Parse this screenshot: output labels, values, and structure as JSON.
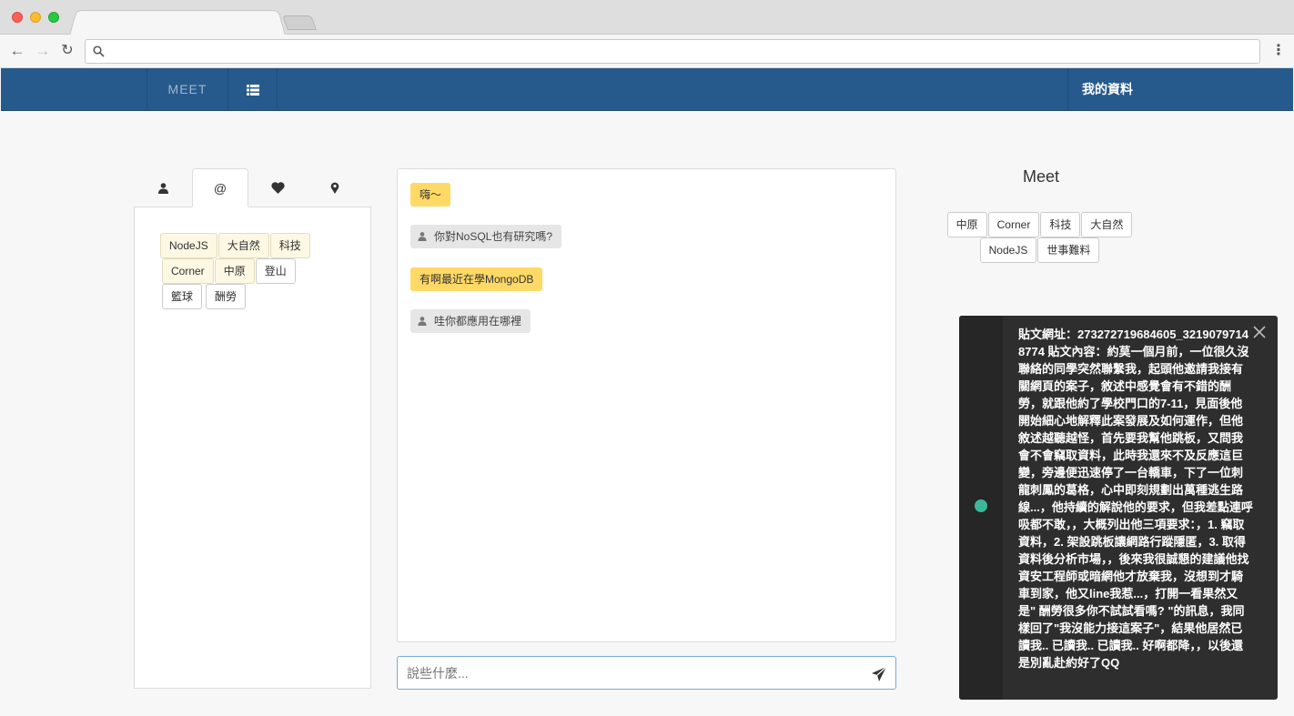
{
  "browser": {
    "tab_title": "",
    "address": ""
  },
  "navbar": {
    "brand": "MEET",
    "right_link": "我的資料"
  },
  "left_tabs": [
    {
      "name": "user-tab",
      "icon": "user-icon"
    },
    {
      "name": "at-tab",
      "label": "@"
    },
    {
      "name": "heart-tab",
      "icon": "heart-icon"
    },
    {
      "name": "location-tab",
      "icon": "map-marker-icon"
    }
  ],
  "interest_tags": {
    "row1": [
      "NodeJS",
      "大自然",
      "科技"
    ],
    "row2": [
      "Corner",
      "中原",
      "登山"
    ],
    "row3": [
      "籃球",
      "酬勞"
    ]
  },
  "chat": {
    "messages": [
      {
        "from": "me",
        "text": "嗨～"
      },
      {
        "from": "other",
        "text": "你對NoSQL也有研究嗎?"
      },
      {
        "from": "me",
        "text": "有啊最近在學MongoDB"
      },
      {
        "from": "other",
        "text": "哇你都應用在哪裡"
      }
    ],
    "input_placeholder": "說些什麼..."
  },
  "match": {
    "title": "Meet",
    "tags_row1": [
      "中原",
      "Corner",
      "科技",
      "大自然"
    ],
    "tags_row2": [
      "NodeJS",
      "世事難料"
    ]
  },
  "notification": {
    "text": "貼文網址：273272719684605_32190797148774 貼文內容：約莫一個月前，一位很久沒聯絡的同學突然聯繫我，起頭他邀請我接有關網頁的案子，敘述中感覺會有不錯的酬勞，就跟他約了學校門口的7-11，見面後他開始細心地解釋此案發展及如何運作，但他敘述越聽越怪，首先要我幫他跳板，又問我會不會竊取資料，此時我還來不及反應這巨變，旁邊便迅速停了一台轎車，下了一位刺龍刺鳳的葛格，心中即刻規劃出萬種逃生路線...，他持續的解說他的要求，但我差點連呼吸都不敢，，大概列出他三項要求：，1. 竊取資料，2. 架設跳板讓網路行蹤隱匿，3. 取得資料後分析市場，，後來我很誠懇的建議他找資安工程師或暗網他才放棄我，沒想到才騎車到家，他又line我惹...，打開一看果然又是\" 酬勞很多你不試試看嗎? \"的訊息，我同樣回了\"我沒能力接這案子\"，結果他居然已讀我.. 已讀我.. 已讀我.. 好啊都降，，以後還是別亂赴約好了QQ",
    "status_color": "#3bb89a"
  },
  "colors": {
    "navbar": "#265a8d",
    "my_message": "#ffd966",
    "other_message": "#e6e6e6",
    "selected_tag": "#fcf8e3"
  }
}
